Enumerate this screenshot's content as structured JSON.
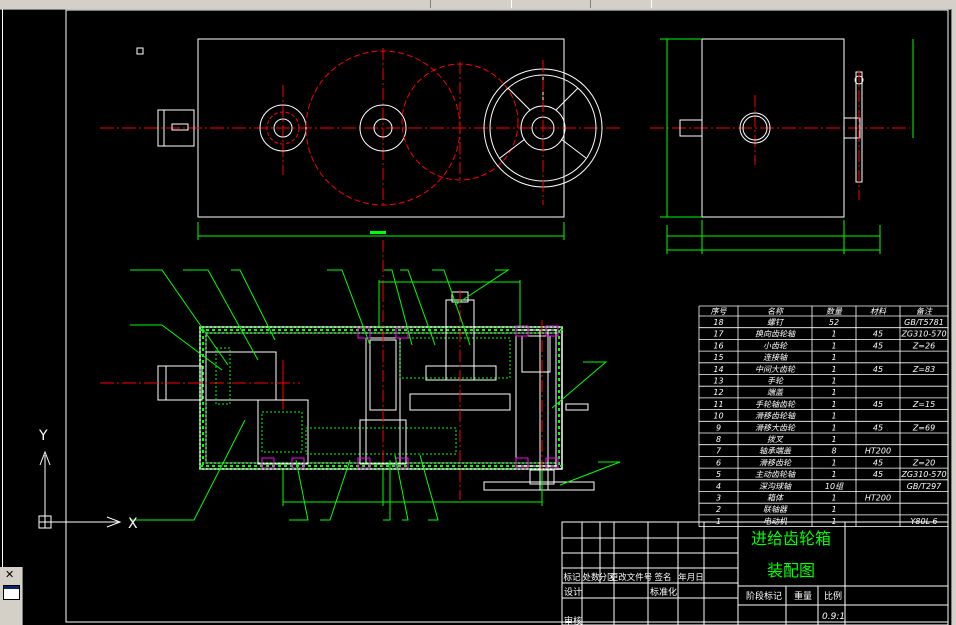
{
  "colors": {
    "background": "#000000",
    "frame": "#ffffff",
    "dim": "#00ff00",
    "center": "#ff0000",
    "part": "#ffffff",
    "gear": "#00ff00",
    "bearing": "#ff00ff"
  },
  "ucs": {
    "y_label": "Y",
    "x_label": "X"
  },
  "title_block": {
    "title_line1": "进给齿轮箱",
    "title_line2": "装配图",
    "row_headers": [
      "标记",
      "处数",
      "分区",
      "更改文件号",
      "签名",
      "年月日"
    ],
    "design_label": "设计",
    "standard_label": "标准化",
    "review_label": "审核",
    "stage_label": "阶段标记",
    "weight_label": "重量",
    "scale_label": "比例",
    "scale_value": "0.9:1"
  },
  "bom": {
    "headers": [
      "序号",
      "名称",
      "数量",
      "材料",
      "备注"
    ],
    "rows": [
      {
        "no": "18",
        "name": "螺钉",
        "qty": "52",
        "mat": "",
        "note": "GB/T5781"
      },
      {
        "no": "17",
        "name": "换向齿轮轴",
        "qty": "1",
        "mat": "45",
        "note": "ZG310-570"
      },
      {
        "no": "16",
        "name": "小齿轮",
        "qty": "1",
        "mat": "45",
        "note": "Z=26"
      },
      {
        "no": "15",
        "name": "连接轴",
        "qty": "1",
        "mat": "",
        "note": ""
      },
      {
        "no": "14",
        "name": "中间大齿轮",
        "qty": "1",
        "mat": "45",
        "note": "Z=83"
      },
      {
        "no": "13",
        "name": "手轮",
        "qty": "1",
        "mat": "",
        "note": ""
      },
      {
        "no": "12",
        "name": "端盖",
        "qty": "1",
        "mat": "",
        "note": ""
      },
      {
        "no": "11",
        "name": "手轮轴齿轮",
        "qty": "1",
        "mat": "45",
        "note": "Z=15"
      },
      {
        "no": "10",
        "name": "滑移齿轮轴",
        "qty": "1",
        "mat": "",
        "note": ""
      },
      {
        "no": "9",
        "name": "滑移大齿轮",
        "qty": "1",
        "mat": "45",
        "note": "Z=69"
      },
      {
        "no": "8",
        "name": "拨叉",
        "qty": "1",
        "mat": "",
        "note": ""
      },
      {
        "no": "7",
        "name": "轴承端盖",
        "qty": "8",
        "mat": "HT200",
        "note": ""
      },
      {
        "no": "6",
        "name": "滑移齿轮",
        "qty": "1",
        "mat": "45",
        "note": "Z=20"
      },
      {
        "no": "5",
        "name": "主动齿轮轴",
        "qty": "1",
        "mat": "45",
        "note": "ZG310-570"
      },
      {
        "no": "4",
        "name": "深沟球轴",
        "qty": "10组",
        "mat": "",
        "note": "GB/T297"
      },
      {
        "no": "3",
        "name": "箱体",
        "qty": "1",
        "mat": "HT200",
        "note": ""
      },
      {
        "no": "2",
        "name": "联轴器",
        "qty": "1",
        "mat": "",
        "note": ""
      },
      {
        "no": "1",
        "name": "电动机",
        "qty": "1",
        "mat": "",
        "note": "Y80L-6"
      }
    ]
  },
  "icons": [
    "close-icon",
    "window-icon"
  ]
}
